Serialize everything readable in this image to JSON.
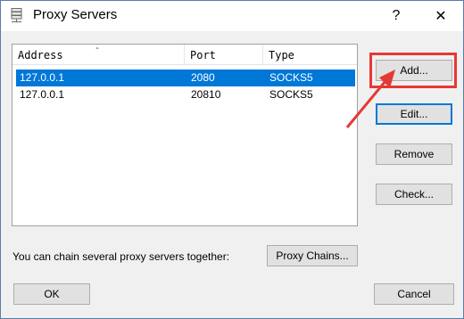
{
  "window": {
    "title": "Proxy Servers",
    "help_glyph": "?",
    "close_glyph": "✕"
  },
  "list": {
    "columns": [
      "Address",
      "Port",
      "Type"
    ],
    "sort_indicator": "ˆ",
    "rows": [
      {
        "address": "127.0.0.1",
        "port": "2080",
        "type": "SOCKS5",
        "selected": true
      },
      {
        "address": "127.0.0.1",
        "port": "20810",
        "type": "SOCKS5",
        "selected": false
      }
    ]
  },
  "buttons": {
    "add": "Add...",
    "edit": "Edit...",
    "remove": "Remove",
    "check": "Check...",
    "proxy_chains": "Proxy Chains...",
    "ok": "OK",
    "cancel": "Cancel"
  },
  "chain_hint": "You can chain several proxy servers together:",
  "colors": {
    "selection": "#0078d7",
    "annotation": "#e53935",
    "dialog_bg": "#f0f0f0"
  },
  "icons": {
    "title": "server-icon",
    "annotation": "red-arrow-icon"
  }
}
